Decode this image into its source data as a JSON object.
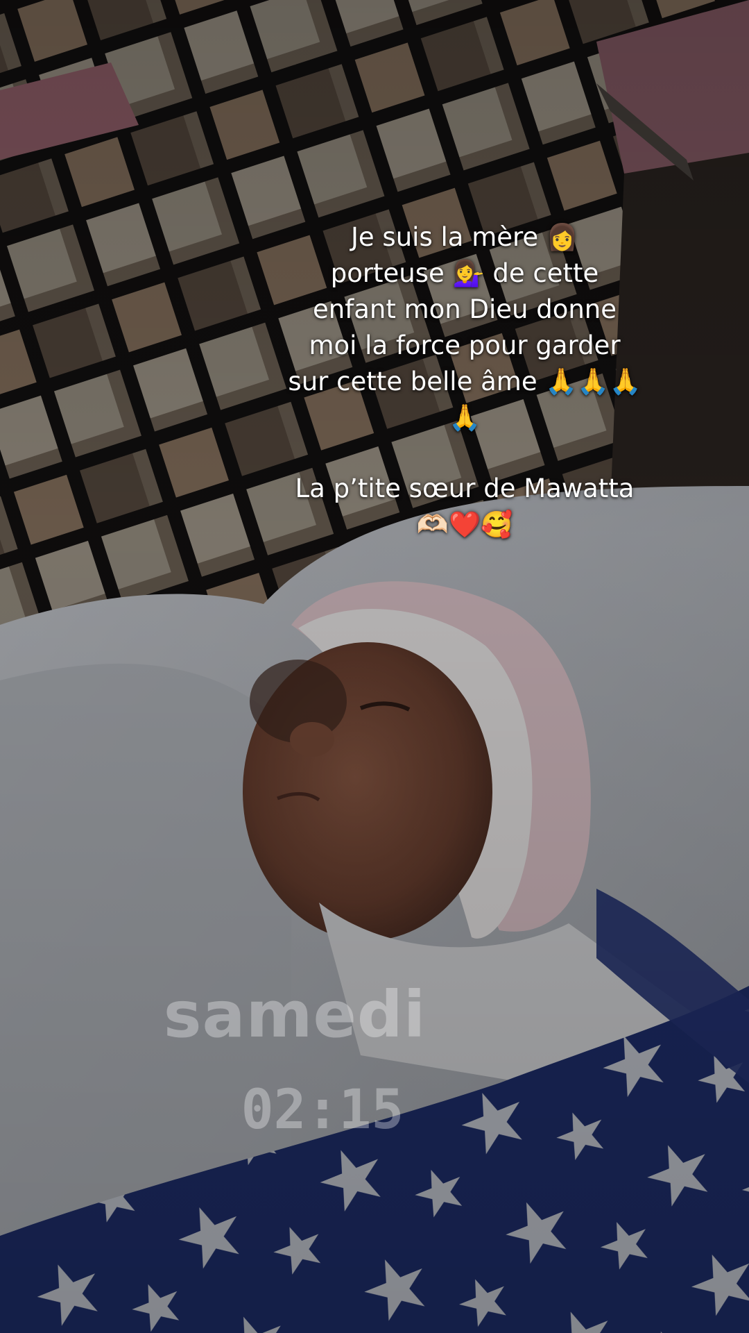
{
  "caption": {
    "lines": [
      "Je suis la mère 👩",
      "porteuse 💁‍♀️ de cette",
      "enfant mon Dieu donne",
      "moi la force pour garder",
      "sur cette belle âme 🙏🙏🙏",
      "🙏"
    ],
    "subtitle": "La p’tite sœur de Mawatta",
    "emojis": "🫶🏻❤️🥰"
  },
  "timestamp": {
    "day": "samedi",
    "time": "02:15"
  },
  "colors": {
    "blanket_navy": "#1f2f6e",
    "towel_white": "#b9bcc2",
    "hat_pink": "#e6c9cf",
    "skin": "#7a4a36"
  }
}
